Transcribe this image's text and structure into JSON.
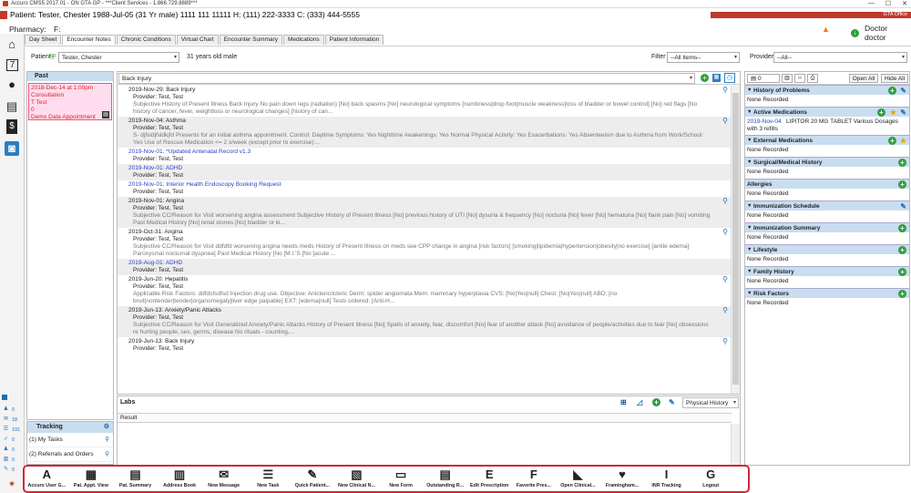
{
  "window": {
    "title": "Accuro CMS5 2017.01 - ON GTA GP - ***Client Services - 1.866.729.8889***",
    "minimize": "—",
    "maximize": "☐",
    "close": "✕"
  },
  "patient_header": {
    "line": "Patient: Tester, Chester 1988-Jul-05 (31 Yr male) 1111 111 11111 H: (111) 222-3333 C: (333) 444-5555",
    "pharmacy_label": "Pharmacy:",
    "pharmacy_value": "F:",
    "office": "GTA Office",
    "doctor": "Doctor doctor"
  },
  "tabs": [
    {
      "label": "Day Sheet"
    },
    {
      "label": "Encounter Notes"
    },
    {
      "label": "Chronic Conditions"
    },
    {
      "label": "Virtual Chart"
    },
    {
      "label": "Encounter Summary"
    },
    {
      "label": "Medications"
    },
    {
      "label": "Patient Information"
    }
  ],
  "patient_row": {
    "patient_label": "Patient",
    "patient_value": "Tester, Chester",
    "age_text": "31 years old male",
    "filter_label": "Filter",
    "filter_value": "--All Items--",
    "providers_label": "Providers",
    "providers_value": "--All--"
  },
  "past": {
    "header": "Past",
    "appointment": {
      "date": "2018-Dec-14 at 1:00pm",
      "type": "Consultation",
      "provider": "T Test",
      "count": "0",
      "title": "Demo Data Appointment"
    }
  },
  "tracking": {
    "header": "Tracking",
    "items": [
      {
        "label": "(1) My Tasks"
      },
      {
        "label": "(2) Referrals and Orders"
      }
    ]
  },
  "left_counts": [
    {
      "value": "0"
    },
    {
      "value": "18"
    },
    {
      "value": "191"
    },
    {
      "value": "0"
    },
    {
      "value": "0"
    },
    {
      "value": "0"
    },
    {
      "value": "0"
    }
  ],
  "notes": {
    "problem_select": "Back Injury",
    "items": [
      {
        "title": "2019-Nov-29: Back Injury",
        "provider": "Provider: Test, Test",
        "summary": "Subjective   History of Present Illness  Back Injury    No pain down legs (radiation)  [No] back spasms  [No] neurological symptoms [numbness|drop foot|muscle weakness|loss of bladder or bowel control]  [No] red flags   [No history of cancer, fever, weightloss or neurological changes]  [history of can..."
      },
      {
        "title": "2019-Nov-04: Asthma",
        "provider": "Provider: Test, Test",
        "summary": "S-  djfsldjfsldkjfd    Presents for an initial asthma appointment.  Control:  Daytime Symptoms: Yes   Nighttime Awakenings: Yes   Normal Physical Activity: Yes   Exacerbations: Yes   Absenteeism due to Asthma from Work/School: Yes   Use of Rescue Medication <= 2 x/week (except prior to exercise):..."
      },
      {
        "title": "2019-Nov-01: *Updated Antenatal Record v1.3",
        "provider": "Provider: Test, Test",
        "summary": ""
      },
      {
        "title": "2019-Nov-01: ADHD",
        "provider": "Provider: Test, Test",
        "summary": ""
      },
      {
        "title": "2019-Nov-01: Interior Health Endoscopy Booking Request",
        "provider": "Provider: Test, Test",
        "summary": ""
      },
      {
        "title": "2019-Nov-01: Angina",
        "provider": "Provider: Test, Test",
        "summary": "Subjective   CC/Reason for Visit  worsening angina  assessment      Subjective   History of Present Illness  [No] previous history of UTI  [No] dysuria & frequency  [No] nocturia  [No] fever  [No] hematuria  [No] flank pain  [No] vomiting   Past Medical History  [No] renal stones  [No] bladder or ki..."
      },
      {
        "title": "2019-Oct-31: Angina",
        "provider": "Provider: Test, Test",
        "summary": "Subjective   CC/Reason for Visit  ddfdfd  worsening angina  needs meds     History of Present Illness  on meds see CPP  change in angina  [risk factors] [smoking|lipidemia|hypertension|obesity|no exercise]  [ankle edema] Paroxysmal nocturnal dyspnea]   Past Medical History  [No [M.I.'S  [No ]acute ..."
      },
      {
        "title": "2019-Aug-01: ADHD",
        "provider": "Provider: Test, Test",
        "summary": ""
      },
      {
        "title": "2019-Jun-20: Hepatitis",
        "provider": "Provider: Test, Test",
        "summary": "Applicable Risk Factors:    ddfdsfsdfsd    Injection drug use.    Objective:   Anicteric/icteric  Derm: spider angiomata  Mem: mammary hyperplasia  CVS: [No|Yes|null]  Chest: [No|Yes|null]  ABD: [no bruit|nontender|tender|organomegaly|liver edge palpable]  EXT: [edema|null]    Tests ordered: [Anti-H..."
      },
      {
        "title": "2019-Jun-13: Anxiety/Panic Attacks",
        "provider": "Provider: Test, Test",
        "summary": "Subjective   CC/Reason for Visit  Generalized Anxiety/Panic Attacks       History of Present Illness  [No] Spells of anxiety, fear, discomfort  [No] fear of another attack  [No] avoidance of people/activities due to fear  [No] obsessions re hurting people, sex, germs, disease  No rituals - counting,..."
      },
      {
        "title": "2019-Jun-13: Back Injury",
        "provider": "Provider: Test, Test",
        "summary": ""
      }
    ]
  },
  "labs": {
    "header": "Labs",
    "column": "Result",
    "view_select": "Physical History"
  },
  "right_panel": {
    "count": "0",
    "open_all": "Open All",
    "hide_all": "Hide All",
    "sections": [
      {
        "title": "History of Problems",
        "body": "None Recorded"
      },
      {
        "title": "Active Medications",
        "body_date": "2019-Nov-04",
        "body": "LIPITOR 20 MG TABLET Various Dosages with 3 refills"
      },
      {
        "title": "External Medications",
        "body": "None Recorded"
      },
      {
        "title": "Surgical/Medical History",
        "body": "None Recorded"
      },
      {
        "title": "Allergies",
        "body": "None Recorded"
      },
      {
        "title": "Immunization Schedule",
        "body": "None Recorded"
      },
      {
        "title": "Immunization Summary",
        "body": "None Recorded"
      },
      {
        "title": "Lifestyle",
        "body": "None Recorded"
      },
      {
        "title": "Family History",
        "body": "None Recorded"
      },
      {
        "title": "Risk Factors",
        "body": "None Recorded"
      }
    ]
  },
  "bottom_toolbar": [
    {
      "label": "Accuro User G...",
      "glyph": "A"
    },
    {
      "label": "Pat. Appt. View",
      "glyph": "▦"
    },
    {
      "label": "Pat. Summary",
      "glyph": "▤"
    },
    {
      "label": "Address Book",
      "glyph": "▥"
    },
    {
      "label": "New Message",
      "glyph": "✉"
    },
    {
      "label": "New Task",
      "glyph": "☰"
    },
    {
      "label": "Quick Patient...",
      "glyph": "✎"
    },
    {
      "label": "New Clinical N...",
      "glyph": "▧"
    },
    {
      "label": "New Form",
      "glyph": "▭"
    },
    {
      "label": "Outstanding R...",
      "glyph": "▤"
    },
    {
      "label": "Edit Prescription",
      "glyph": "E"
    },
    {
      "label": "Favorite Pres...",
      "glyph": "F"
    },
    {
      "label": "Open Clinical...",
      "glyph": "◣"
    },
    {
      "label": "Framingham...",
      "glyph": "♥"
    },
    {
      "label": "INR Tracking",
      "glyph": "I"
    },
    {
      "label": "Logout",
      "glyph": "G"
    }
  ]
}
